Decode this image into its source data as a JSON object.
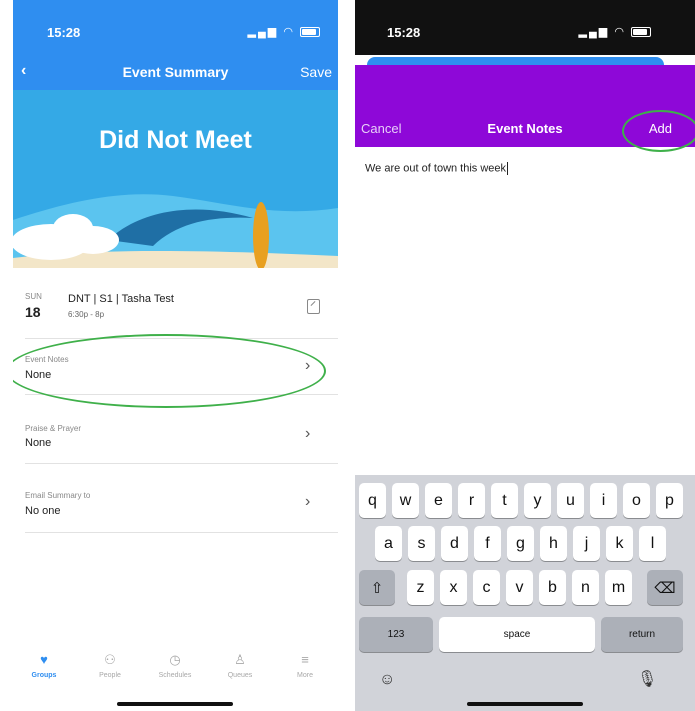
{
  "left": {
    "status": {
      "time": "15:28"
    },
    "nav": {
      "back": "‹",
      "title": "Event Summary",
      "save": "Save"
    },
    "banner": {
      "title": "Did Not Meet"
    },
    "event": {
      "day": "SUN",
      "date": "18",
      "name": "DNT | S1 | Tasha Test",
      "time": "6:30p - 8p"
    },
    "rows": [
      {
        "label": "Event Notes",
        "value": "None"
      },
      {
        "label": "Praise & Prayer",
        "value": "None"
      },
      {
        "label": "Email Summary to",
        "value": "No one"
      }
    ],
    "tabs": [
      {
        "label": "Groups",
        "icon": "groups-icon"
      },
      {
        "label": "People",
        "icon": "people-icon"
      },
      {
        "label": "Schedules",
        "icon": "clock-icon"
      },
      {
        "label": "Queues",
        "icon": "queues-icon"
      },
      {
        "label": "More",
        "icon": "menu-icon"
      }
    ],
    "colors": {
      "header": "#2f8ef0",
      "highlight": "#3fb04a"
    }
  },
  "right": {
    "status": {
      "time": "15:28"
    },
    "nav": {
      "cancel": "Cancel",
      "title": "Event Notes",
      "add": "Add"
    },
    "note_text": "We are out of town this week",
    "keyboard": {
      "row1": [
        "q",
        "w",
        "e",
        "r",
        "t",
        "y",
        "u",
        "i",
        "o",
        "p"
      ],
      "row2": [
        "a",
        "s",
        "d",
        "f",
        "g",
        "h",
        "j",
        "k",
        "l"
      ],
      "row3": [
        "z",
        "x",
        "c",
        "v",
        "b",
        "n",
        "m"
      ],
      "numbers": "123",
      "space": "space",
      "return": "return"
    },
    "colors": {
      "header": "#8e08d8"
    }
  }
}
